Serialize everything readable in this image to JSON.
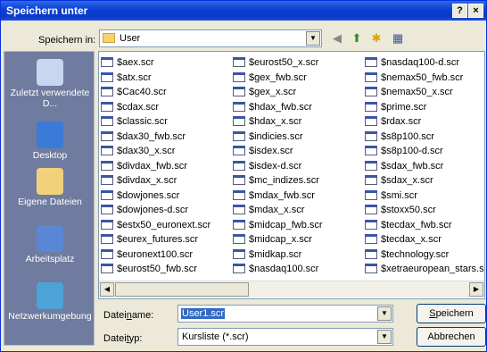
{
  "window": {
    "title": "Speichern unter",
    "help_glyph": "?",
    "close_glyph": "×"
  },
  "lookin": {
    "label": "Speichern in:",
    "value": "User"
  },
  "places": [
    {
      "label": "Zuletzt verwendete D...",
      "icon": "recent-icon"
    },
    {
      "label": "Desktop",
      "icon": "desktop-icon"
    },
    {
      "label": "Eigene Dateien",
      "icon": "my-documents-icon"
    },
    {
      "label": "Arbeitsplatz",
      "icon": "my-computer-icon"
    },
    {
      "label": "Netzwerkumgebung",
      "icon": "network-icon"
    }
  ],
  "files": {
    "col1": [
      "$aex.scr",
      "$atx.scr",
      "$Cac40.scr",
      "$cdax.scr",
      "$classic.scr",
      "$dax30_fwb.scr",
      "$dax30_x.scr",
      "$divdax_fwb.scr",
      "$divdax_x.scr",
      "$dowjones.scr",
      "$dowjones-d.scr",
      "$estx50_euronext.scr",
      "$eurex_futures.scr",
      "$euronext100.scr",
      "$eurost50_fwb.scr"
    ],
    "col2": [
      "$eurost50_x.scr",
      "$gex_fwb.scr",
      "$gex_x.scr",
      "$hdax_fwb.scr",
      "$hdax_x.scr",
      "$indicies.scr",
      "$isdex.scr",
      "$isdex-d.scr",
      "$mc_indizes.scr",
      "$mdax_fwb.scr",
      "$mdax_x.scr",
      "$midcap_fwb.scr",
      "$midcap_x.scr",
      "$midkap.scr",
      "$nasdaq100.scr"
    ],
    "col3": [
      "$nasdaq100-d.scr",
      "$nemax50_fwb.scr",
      "$nemax50_x.scr",
      "$prime.scr",
      "$rdax.scr",
      "$s8p100.scr",
      "$s8p100-d.scr",
      "$sdax_fwb.scr",
      "$sdax_x.scr",
      "$smi.scr",
      "$stoxx50.scr",
      "$tecdax_fwb.scr",
      "$tecdax_x.scr",
      "$technology.scr",
      "$xetraeuropean_stars.sc"
    ]
  },
  "filename": {
    "label_pre": "Datei",
    "label_u": "n",
    "label_post": "ame:",
    "value": "User1.scr"
  },
  "filetype": {
    "label_pre": "Datei",
    "label_u": "t",
    "label_post": "yp:",
    "value": "Kursliste (*.scr)"
  },
  "buttons": {
    "save_u": "S",
    "save_rest": "peichern",
    "cancel": "Abbrechen"
  },
  "colors": {
    "title_bar": "#0A3FD0",
    "places_bar": "#6F7CA0"
  }
}
